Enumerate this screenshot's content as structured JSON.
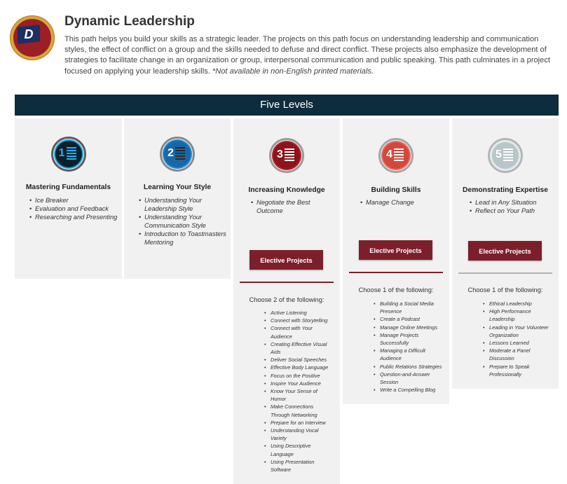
{
  "header": {
    "title": "Dynamic Leadership",
    "logo_letter": "D",
    "description": "This path helps you build your skills as a strategic leader. The projects on this path focus on understanding leadership and communication styles, the effect of conflict on a group and the skills needed to defuse and direct conflict. These projects also emphasize the development of strategies to facilitate change in an organization or group, interpersonal communication and public speaking. This path culminates in a project focused on applying your leadership skills.",
    "note": "*Not available in non-English printed materials."
  },
  "banner": "Five Levels",
  "levels": [
    {
      "number": "1",
      "title": "Mastering Fundamentals",
      "color": "#0b1f2c",
      "projects": [
        "Ice Breaker",
        "Evaluation and Feedback",
        "Researching and Presenting"
      ]
    },
    {
      "number": "2",
      "title": "Learning Your Style",
      "color": "#1868a8",
      "projects": [
        "Understanding Your Leadership Style",
        "Understanding Your Communication Style",
        "Introduction to Toastmasters Mentoring"
      ]
    },
    {
      "number": "3",
      "title": "Increasing Knowledge",
      "color": "#8c141a",
      "projects": [
        "Negotiate the Best Outcome"
      ],
      "elective_label": "Elective Projects",
      "choose": "Choose 2 of the following:",
      "electives": [
        "Active Listening",
        "Connect with Storytelling",
        "Connect with Your Audience",
        "Creating Effective Visual Aids",
        "Deliver Social Speeches",
        "Effective Body Language",
        "Focus on the Positive",
        "Inspire Your Audience",
        "Know Your Sense of Humor",
        "Make Connections Through Networking",
        "Prepare for an Interview",
        "Understanding Vocal Variety",
        "Using Descriptive Language",
        "Using Presentation Software"
      ]
    },
    {
      "number": "4",
      "title": "Building Skills",
      "color": "#d3483c",
      "projects": [
        "Manage Change"
      ],
      "elective_label": "Elective Projects",
      "choose": "Choose 1 of the following:",
      "electives": [
        "Building a Social Media Presence",
        "Create a Podcast",
        "Manage Online Meetings",
        "Manage Projects Successfully",
        "Managing a Difficult Audience",
        "Public Relations Strategies",
        "Question-and-Answer Session",
        "Write a Compelling Blog"
      ]
    },
    {
      "number": "5",
      "title": "Demonstrating Expertise",
      "color": "#b7c6c9",
      "projects": [
        "Lead in Any Situation",
        "Reflect on Your Path"
      ],
      "elective_label": "Elective Projects",
      "choose": "Choose 1 of the following:",
      "electives": [
        "Ethical Leadership",
        "High Performance Leadership",
        "Leading in Your Volunteer Organization",
        "Lessons Learned",
        "Moderate a Panel Discussion",
        "Prepare to Speak Professionally"
      ]
    }
  ],
  "colors": {
    "banner": "#0d2c3d",
    "elective_button": "#7d1f2b",
    "column_bg": "#f1f1f1"
  }
}
